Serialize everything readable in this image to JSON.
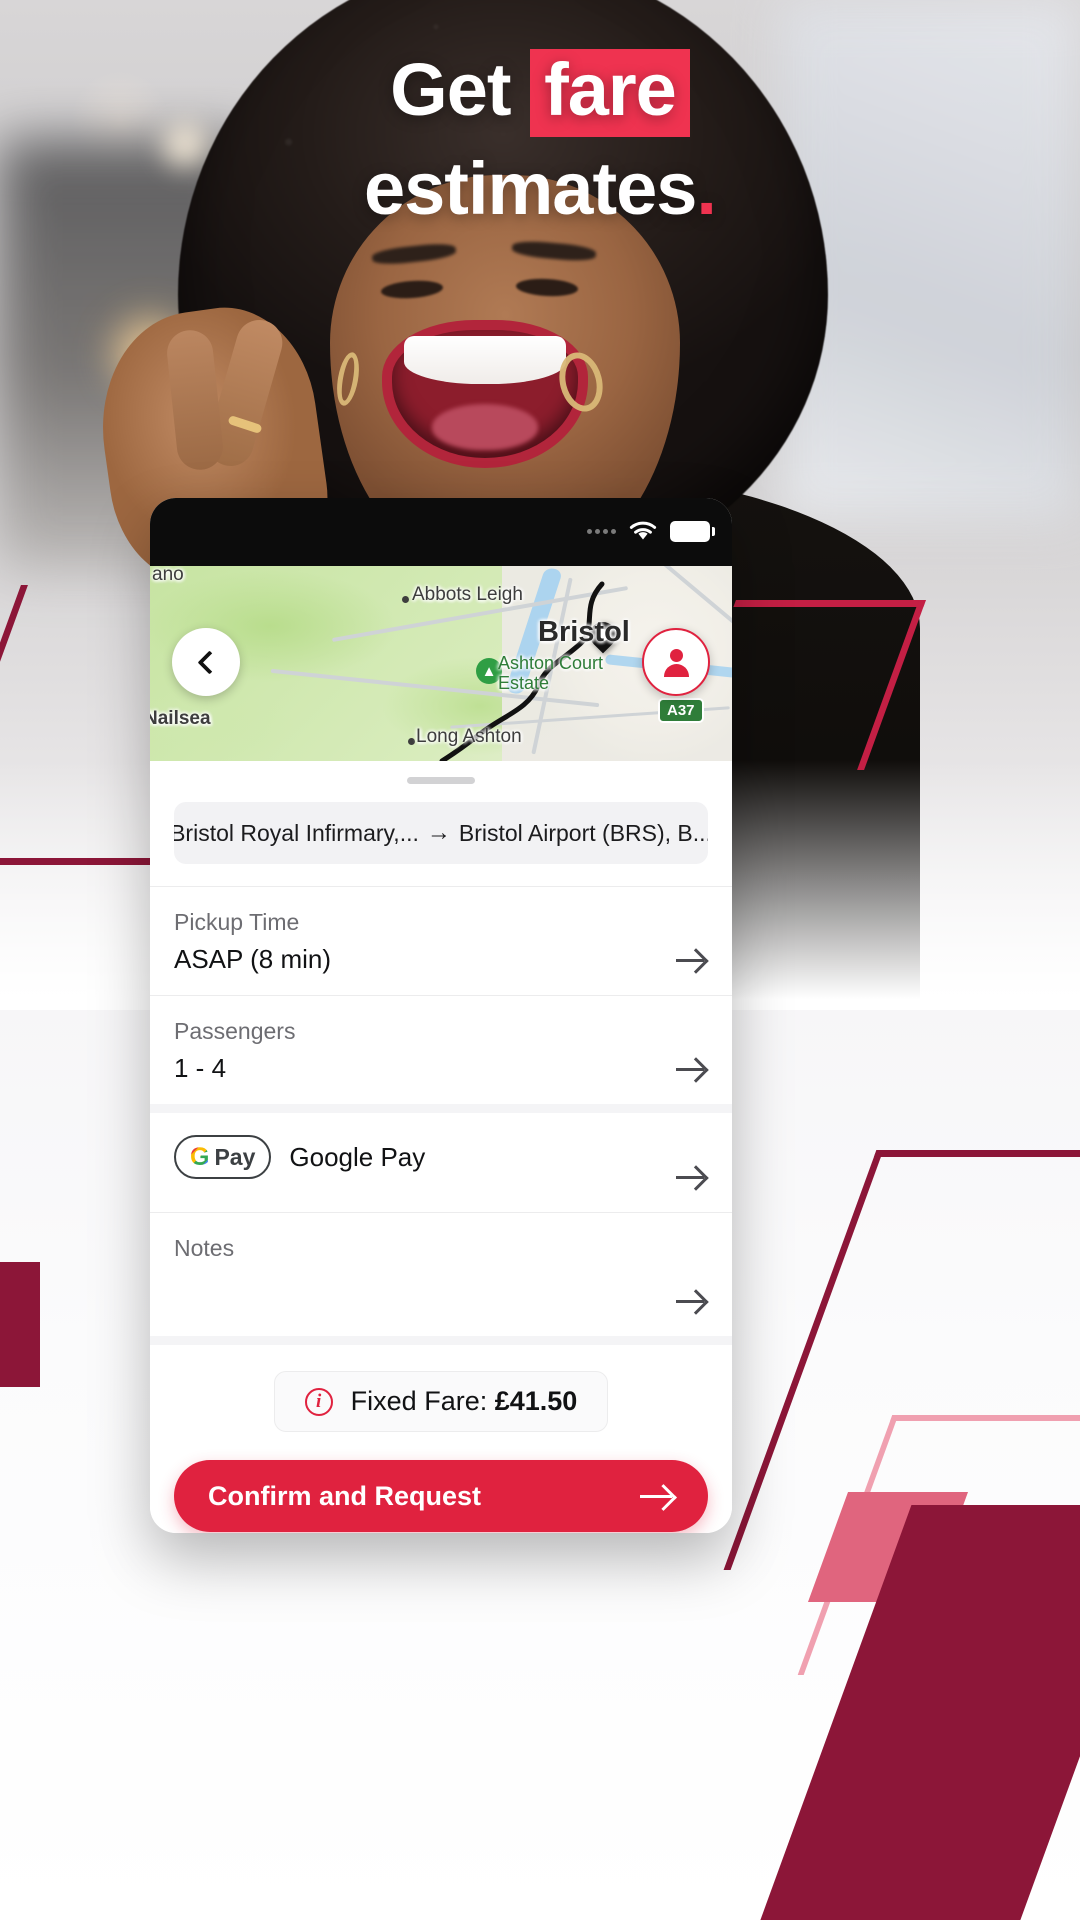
{
  "hero": {
    "line1_prefix": "Get",
    "line1_highlight": "fare",
    "line2": "estimates",
    "line2_dot": ".",
    "highlight_color": "#ef3350"
  },
  "phone": {
    "status_bar": {
      "signal_icon": "signal-dots-icon",
      "wifi_icon": "wifi-icon",
      "battery_icon": "battery-icon"
    },
    "map": {
      "back_icon": "chevron-left-icon",
      "account_icon": "person-icon",
      "destination_pin_icon": "map-pin-icon",
      "labels": [
        {
          "text": "ano",
          "type": "place"
        },
        {
          "text": "Abbots Leigh",
          "type": "place"
        },
        {
          "text": "Bristol",
          "type": "city"
        },
        {
          "text": "Ashton Court Estate",
          "type": "park"
        },
        {
          "text": "Nailsea",
          "type": "place"
        },
        {
          "text": "Long Ashton",
          "type": "place"
        },
        {
          "text": "A37",
          "type": "road-shield"
        }
      ],
      "park_icon": "tree-icon"
    },
    "sheet": {
      "grabber": "drag-handle",
      "route": {
        "pickup": "Bristol Royal Infirmary,...",
        "arrow": "→",
        "dropoff": "Bristol Airport (BRS), B..."
      },
      "rows": [
        {
          "label": "Pickup Time",
          "value": "ASAP (8 min)",
          "arrow_icon": "arrow-right-icon"
        },
        {
          "label": "Passengers",
          "value": "1 - 4",
          "arrow_icon": "arrow-right-icon"
        }
      ],
      "payment": {
        "badge_g": "G",
        "badge_pay": "Pay",
        "label": "Google Pay",
        "arrow_icon": "arrow-right-icon"
      },
      "notes": {
        "label": "Notes",
        "arrow_icon": "arrow-right-icon"
      },
      "fare": {
        "info_icon": "info-icon",
        "label": "Fixed Fare:",
        "amount": "£41.50"
      },
      "cta": {
        "label": "Confirm and Request",
        "arrow_icon": "arrow-right-icon",
        "color": "#e0223f"
      }
    }
  }
}
